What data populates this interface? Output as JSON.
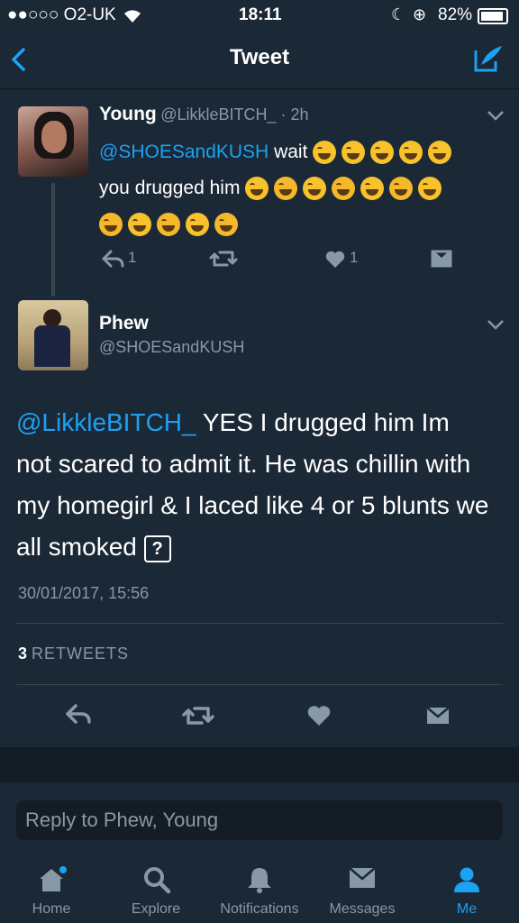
{
  "status_bar": {
    "carrier": "●●○○○ O2-UK",
    "time": "18:11",
    "battery": "82%"
  },
  "nav": {
    "title": "Tweet",
    "back_icon": "chevron-left-icon",
    "compose_icon": "compose-tweet-icon"
  },
  "parent_tweet": {
    "name": "Young",
    "handle_time": "@LikkleBITCH_ · 2h",
    "mention": "@SHOESandKUSH",
    "text1": " wait ",
    "text2": "you drugged him ",
    "reply_count": "1",
    "like_count": "1"
  },
  "main_tweet": {
    "name": "Phew",
    "handle": "@SHOESandKUSH",
    "mention": "@LikkleBITCH_",
    "text": " YES I drugged him Im not scared to admit it. He was chillin with my homegirl & I laced like 4 or 5 blunts we all smoked",
    "unknown_glyph": "?",
    "timestamp": "30/01/2017, 15:56",
    "retweets_count": "3",
    "retweets_label": "RETWEETS"
  },
  "reply": {
    "placeholder": "Reply to Phew, Young"
  },
  "tabs": [
    {
      "label": "Home",
      "icon": "home-icon"
    },
    {
      "label": "Explore",
      "icon": "search-icon"
    },
    {
      "label": "Notifications",
      "icon": "bell-icon"
    },
    {
      "label": "Messages",
      "icon": "envelope-icon"
    },
    {
      "label": "Me",
      "icon": "person-icon"
    }
  ],
  "colors": {
    "accent": "#1da1f2",
    "background": "#1b2836",
    "muted": "#8899a6"
  }
}
